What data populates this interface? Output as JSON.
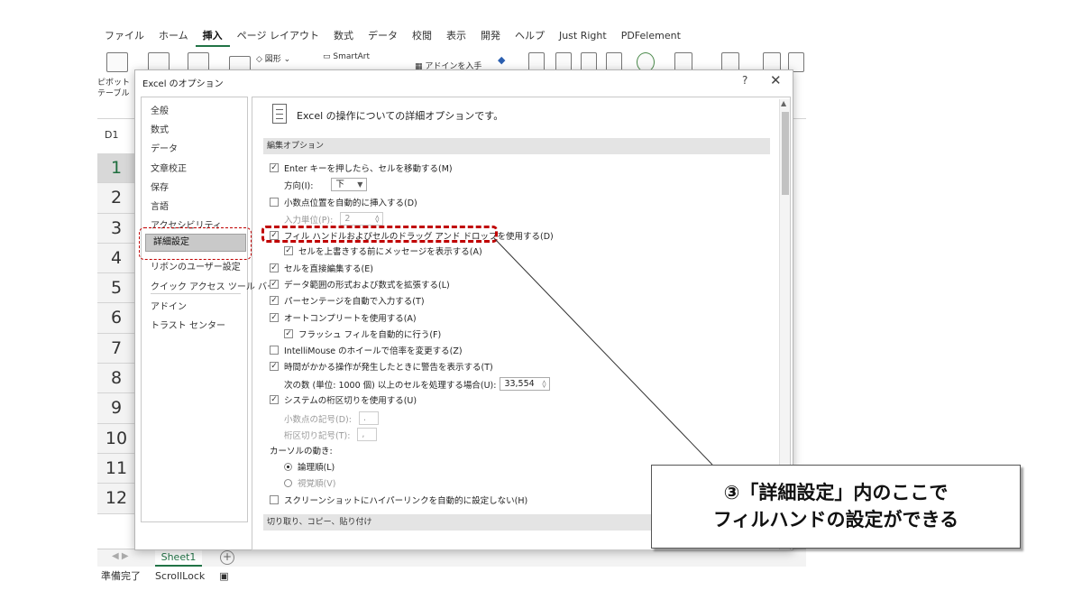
{
  "ribbon": {
    "tabs": [
      "ファイル",
      "ホーム",
      "挿入",
      "ページ レイアウト",
      "数式",
      "データ",
      "校閲",
      "表示",
      "開発",
      "ヘルプ",
      "Just Right",
      "PDFelement"
    ],
    "active_tab": "挿入",
    "shapes_label": "図形",
    "smartart_label": "SmartArt",
    "addin_label": "アドインを入手",
    "pivot_label_1": "ピボット",
    "pivot_label_2": "テーブル"
  },
  "namebox": "D1",
  "rows": [
    "1",
    "2",
    "3",
    "4",
    "5",
    "6",
    "7",
    "8",
    "9",
    "10",
    "11",
    "12"
  ],
  "sheet_tab": "Sheet1",
  "sheet_add": "+",
  "status": [
    "準備完了",
    "ScrollLock"
  ],
  "dialog": {
    "title": "Excel のオプション",
    "help": "?",
    "close": "✕",
    "nav": [
      "全般",
      "数式",
      "データ",
      "文章校正",
      "保存",
      "言語",
      "アクセシビリティ",
      "詳細設定",
      "リボンのユーザー設定",
      "クイック アクセス ツール バー",
      "アドイン",
      "トラスト センター"
    ],
    "active_nav": "詳細設定",
    "panel_header": "Excel の操作についての詳細オプションです。",
    "section_edit": "編集オプション",
    "section_clip": "切り取り、コピー、貼り付け",
    "options": {
      "enter_move": "Enter キーを押したら、セルを移動する(M)",
      "direction_label": "方向(I):",
      "direction_value": "下",
      "auto_decimal": "小数点位置を自動的に挿入する(D)",
      "places_label": "入力単位(P):",
      "places_value": "2",
      "fill_handle": "フィル ハンドルおよびセルのドラッグ アンド ドロップを使用する(D)",
      "overwrite_alert": "セルを上書きする前にメッセージを表示する(A)",
      "edit_in_cell": "セルを直接編集する(E)",
      "extend_formats": "データ範囲の形式および数式を拡張する(L)",
      "auto_percent": "パーセンテージを自動で入力する(T)",
      "autocomplete": "オートコンプリートを使用する(A)",
      "flash_fill": "フラッシュ フィルを自動的に行う(F)",
      "intellimouse": "IntelliMouse のホイールで倍率を変更する(Z)",
      "slow_alert": "時間がかかる操作が発生したときに警告を表示する(T)",
      "cells_label": "次の数 (単位: 1000 個) 以上のセルを処理する場合(U):",
      "cells_value": "33,554",
      "system_sep": "システムの桁区切りを使用する(U)",
      "decimal_sep_label": "小数点の記号(D):",
      "decimal_sep_value": ".",
      "thousands_sep_label": "桁区切り記号(T):",
      "thousands_sep_value": ",",
      "cursor_label": "カーソルの動き:",
      "logical": "論理順(L)",
      "visual": "視覚順(V)",
      "no_hyperlink": "スクリーンショットにハイパーリンクを自動的に設定しない(H)"
    }
  },
  "callout": {
    "line1": "③「詳細設定」内のここで",
    "line2": "フィルハンドの設定ができる"
  },
  "colors": {
    "annotation_red": "#c00000",
    "excel_green": "#217346"
  }
}
